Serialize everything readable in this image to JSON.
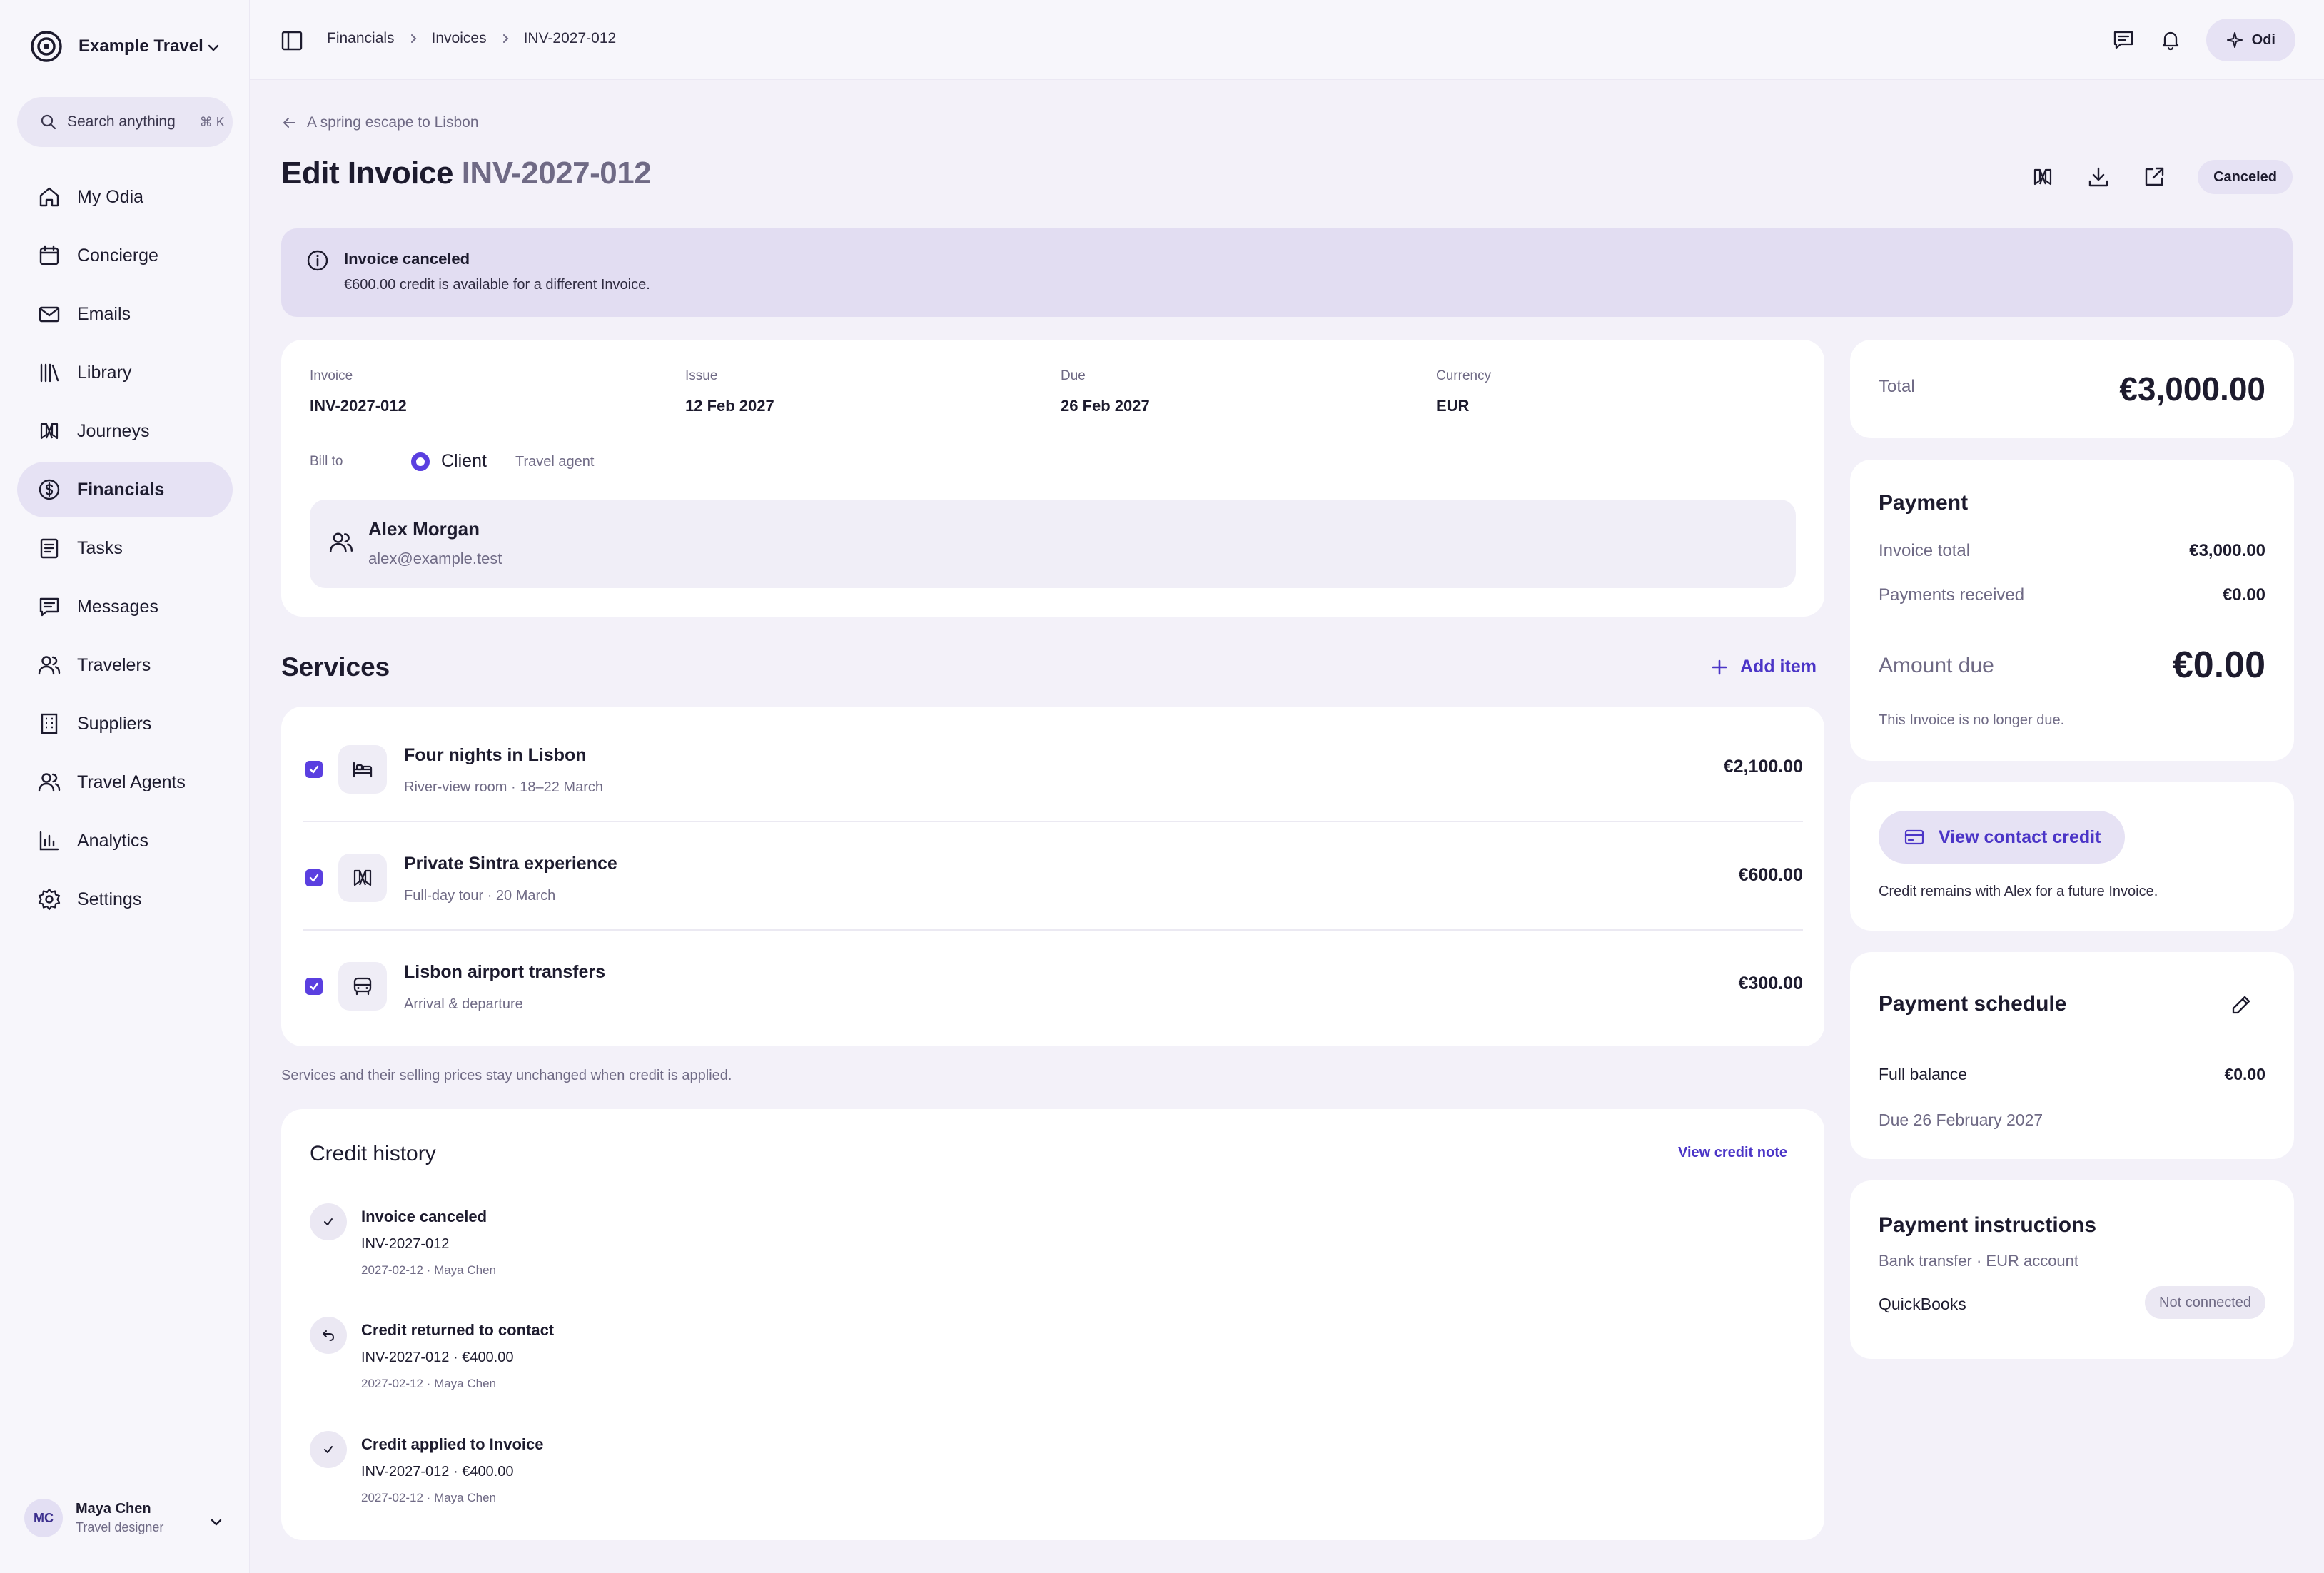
{
  "brand": {
    "name": "Example Travel"
  },
  "search": {
    "label": "Search anything",
    "shortcut": "⌘ K"
  },
  "nav": [
    {
      "label": "My Odia",
      "icon": "home-icon"
    },
    {
      "label": "Concierge",
      "icon": "calendar-icon"
    },
    {
      "label": "Emails",
      "icon": "mail-icon"
    },
    {
      "label": "Library",
      "icon": "library-icon"
    },
    {
      "label": "Journeys",
      "icon": "journeys-icon"
    },
    {
      "label": "Financials",
      "icon": "dollar-icon",
      "active": true
    },
    {
      "label": "Tasks",
      "icon": "tasks-icon"
    },
    {
      "label": "Messages",
      "icon": "message-icon"
    },
    {
      "label": "Travelers",
      "icon": "users-icon"
    },
    {
      "label": "Suppliers",
      "icon": "building-icon"
    },
    {
      "label": "Travel Agents",
      "icon": "users-icon"
    },
    {
      "label": "Analytics",
      "icon": "chart-icon"
    },
    {
      "label": "Settings",
      "icon": "gear-icon"
    }
  ],
  "user": {
    "initials": "MC",
    "name": "Maya Chen",
    "role": "Travel designer"
  },
  "breadcrumb": [
    "Financials",
    "Invoices",
    "INV-2027-012"
  ],
  "topbar": {
    "assistant_label": "Odi"
  },
  "back_link": "A spring escape to Lisbon",
  "title": {
    "prefix": "Edit Invoice",
    "invoice_id": "INV-2027-012"
  },
  "status": "Canceled",
  "alert": {
    "title": "Invoice canceled",
    "text": "€600.00 credit is available for a different Invoice."
  },
  "invoice_meta": [
    {
      "label": "Invoice",
      "value": "INV-2027-012"
    },
    {
      "label": "Issue",
      "value": "12 Feb 2027"
    },
    {
      "label": "Due",
      "value": "26 Feb 2027"
    },
    {
      "label": "Currency",
      "value": "EUR"
    }
  ],
  "bill_to": {
    "label": "Bill to",
    "options": [
      "Client",
      "Travel agent"
    ],
    "selected": "Client",
    "client_name": "Alex Morgan",
    "client_email": "alex@example.test"
  },
  "services": {
    "title": "Services",
    "add_label": "Add item",
    "items": [
      {
        "title": "Four nights in Lisbon",
        "subtitle": "River-view room · 18–22 March",
        "price": "€2,100.00",
        "icon": "bed-icon",
        "checked": true
      },
      {
        "title": "Private Sintra experience",
        "subtitle": "Full-day tour · 20 March",
        "price": "€600.00",
        "icon": "journeys-icon",
        "checked": true
      },
      {
        "title": "Lisbon airport transfers",
        "subtitle": "Arrival & departure",
        "price": "€300.00",
        "icon": "car-icon",
        "checked": true
      }
    ],
    "note": "Services and their selling prices stay unchanged when credit is applied."
  },
  "credit_history": {
    "title": "Credit history",
    "link": "View credit note",
    "items": [
      {
        "title": "Invoice canceled",
        "ref": "INV-2027-012",
        "meta": "2027-02-12 · Maya Chen",
        "icon": "check-icon"
      },
      {
        "title": "Credit returned to contact",
        "ref": "INV-2027-012 · €400.00",
        "meta": "2027-02-12 · Maya Chen",
        "icon": "undo-icon"
      },
      {
        "title": "Credit applied to Invoice",
        "ref": "INV-2027-012 · €400.00",
        "meta": "2027-02-12 · Maya Chen",
        "icon": "check-icon"
      }
    ]
  },
  "total": {
    "label": "Total",
    "value": "€3,000.00"
  },
  "payment": {
    "title": "Payment",
    "invoice_total_label": "Invoice total",
    "invoice_total": "€3,000.00",
    "received_label": "Payments received",
    "received": "€0.00",
    "due_label": "Amount due",
    "due": "€0.00",
    "note": "This Invoice is no longer due."
  },
  "contact_credit": {
    "button": "View contact credit",
    "note": "Credit remains with Alex for a future Invoice."
  },
  "schedule": {
    "title": "Payment schedule",
    "row_label": "Full balance",
    "row_value": "€0.00",
    "due": "Due 26 February 2027"
  },
  "instructions": {
    "title": "Payment instructions",
    "subtitle": "Bank transfer · EUR account",
    "integration": "QuickBooks",
    "integration_status": "Not connected"
  },
  "colors": {
    "accent": "#5a3fe0",
    "accent_text": "#4b35c7",
    "background": "#f3f1f9",
    "alert_bg": "#e2ddf2"
  }
}
